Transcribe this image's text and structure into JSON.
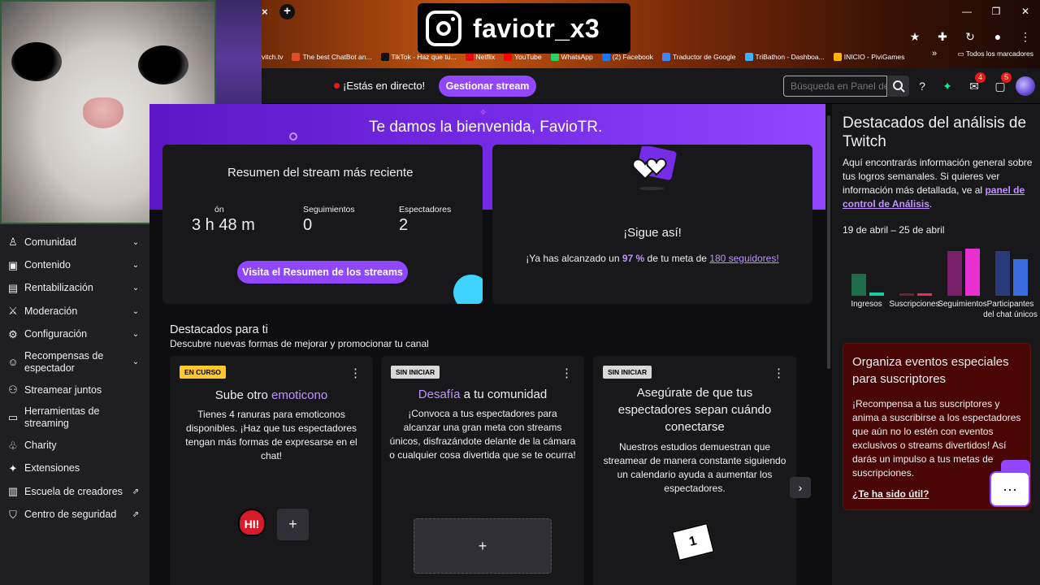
{
  "browser": {
    "tab_close_glyph": "×",
    "new_tab_glyph": "+",
    "window_buttons": [
      "—",
      "❐",
      "✕"
    ],
    "bookmarks": [
      {
        "label": "vitch.tv",
        "color": "#9147ff"
      },
      {
        "label": "The best ChatBot an...",
        "color": "#e34c26"
      },
      {
        "label": "TikTok - Haz que tu...",
        "color": "#111111"
      },
      {
        "label": "Netflix",
        "color": "#e50914"
      },
      {
        "label": "YouTube",
        "color": "#ff0000"
      },
      {
        "label": "WhatsApp",
        "color": "#25d366"
      },
      {
        "label": "(2) Facebook",
        "color": "#1877f2"
      },
      {
        "label": "Traductor de Google",
        "color": "#4285f4"
      },
      {
        "label": "TriBathon - Dashboa...",
        "color": "#37b3ff"
      },
      {
        "label": "INICIO - PiviGames",
        "color": "#ffb400"
      }
    ],
    "bookmarks_more": "»",
    "all_bookmarks": "Todos los marcadores"
  },
  "overlay": {
    "instagram_handle": "faviotr_x3"
  },
  "nav": {
    "live_label": "¡Estás en directo!",
    "manage_stream": "Gestionar stream",
    "search_placeholder": "Búsqueda en Panel de control",
    "inbox_badge": "4",
    "notifications_badge": "5"
  },
  "sidebar": {
    "items": [
      {
        "label": "Comunidad",
        "icon": "users-icon",
        "glyph": "♙",
        "expandable": true,
        "external": false
      },
      {
        "label": "Contenido",
        "icon": "content-icon",
        "glyph": "▣",
        "expandable": true,
        "external": false
      },
      {
        "label": "Rentabilización",
        "icon": "money-icon",
        "glyph": "▤",
        "expandable": true,
        "external": false
      },
      {
        "label": "Moderación",
        "icon": "sword-icon",
        "glyph": "⚔",
        "expandable": true,
        "external": false
      },
      {
        "label": "Configuración",
        "icon": "gear-icon",
        "glyph": "⚙",
        "expandable": true,
        "external": false
      },
      {
        "label": "Recompensas de espectador",
        "icon": "smile-icon",
        "glyph": "☺",
        "expandable": true,
        "external": false
      },
      {
        "label": "Streamear juntos",
        "icon": "user-plus-icon",
        "glyph": "⚇",
        "expandable": false,
        "external": false
      },
      {
        "label": "Herramientas de streaming",
        "icon": "camera-icon",
        "glyph": "▭",
        "expandable": false,
        "external": false
      },
      {
        "label": "Charity",
        "icon": "charity-icon",
        "glyph": "♧",
        "expandable": false,
        "external": false
      },
      {
        "label": "Extensiones",
        "icon": "puzzle-icon",
        "glyph": "✦",
        "expandable": false,
        "external": false
      },
      {
        "label": "Escuela de creadores",
        "icon": "book-icon",
        "glyph": "▥",
        "expandable": false,
        "external": true
      },
      {
        "label": "Centro de seguridad",
        "icon": "shield-icon",
        "glyph": "⛉",
        "expandable": false,
        "external": true
      }
    ],
    "chevron_glyph": "⌄",
    "external_glyph": "⇗"
  },
  "main": {
    "welcome": "Te damos la bienvenida, FavioTR.",
    "summary": {
      "title": "Resumen del stream más reciente",
      "duration_label": "ón",
      "duration_value": "3 h 48 m",
      "followers_label": "Seguimientos",
      "followers_value": "0",
      "viewers_label": "Espectadores",
      "viewers_value": "2",
      "button": "Visita el Resumen de los streams"
    },
    "goal": {
      "title": "¡Sigue así!",
      "text_prefix": "¡Ya has alcanzado un",
      "percent": "97 %",
      "text_mid": "de tu meta de",
      "goal_link": "180 seguidores!"
    },
    "featured": {
      "title": "Destacados para ti",
      "subtitle": "Descubre nuevas formas de mejorar y promocionar tu canal",
      "cards": [
        {
          "badge": "EN CURSO",
          "title_pre": "Sube otro ",
          "title_hl": "emoticono",
          "title_post": "",
          "body": "Tienes 4 ranuras para emoticonos disponibles. ¡Haz que tus espectadores tengan más formas de expresarse en el chat!",
          "emote_text": "HI!",
          "add": "+"
        },
        {
          "badge": "SIN INICIAR",
          "title_pre": "",
          "title_hl": "Desafía",
          "title_post": " a tu comunidad",
          "body": "¡Convoca a tus espectadores para alcanzar una gran meta con streams únicos, disfrazándote delante de la cámara o cualquier cosa divertida que se te ocurra!",
          "add": "+"
        },
        {
          "badge": "SIN INICIAR",
          "title_pre": "Asegúrate de que tus espectadores sepan cuándo conectarse",
          "title_hl": "",
          "title_post": "",
          "body": "Nuestros estudios demuestran que streamear de manera constante siguiendo un calendario ayuda a aumentar los espectadores.",
          "calendar_day": "1"
        }
      ],
      "next_glyph": "›",
      "dots_glyph": "⋮"
    }
  },
  "right_panel": {
    "title": "Destacados del análisis de Twitch",
    "text": "Aquí encontrarás información general sobre tus logros semanales. Si quieres ver información más detallada, ve al",
    "link": "panel de control de Análisis",
    "link_suffix": ".",
    "range": "19 de abril – 25 de abril",
    "chart": {
      "groups": [
        {
          "label": "Ingresos",
          "values": [
            0.42,
            0.06
          ],
          "colors": [
            "#1f6b4a",
            "#0fd19c"
          ]
        },
        {
          "label": "Suscripciones",
          "values": [
            0.04,
            0.04
          ],
          "colors": [
            "#6b1f2f",
            "#e8304c"
          ]
        },
        {
          "label": "Seguimientos",
          "values": [
            0.86,
            0.9
          ],
          "colors": [
            "#7a1f6a",
            "#e82fd0"
          ]
        },
        {
          "label": "Participantes del chat únicos",
          "values": [
            0.86,
            0.7
          ],
          "colors": [
            "#2a3a7a",
            "#3a6bdc"
          ]
        }
      ]
    },
    "promo": {
      "title": "Organiza eventos especiales para suscriptores",
      "text": "¡Recompensa a tus suscriptores y anima a suscribirse a los espectadores que aún no lo estén con eventos exclusivos o streams divertidos! Así darás un impulso a tus metas de suscripciones.",
      "link": "¿Te ha sido útil?"
    },
    "chat_bubble": "···"
  }
}
